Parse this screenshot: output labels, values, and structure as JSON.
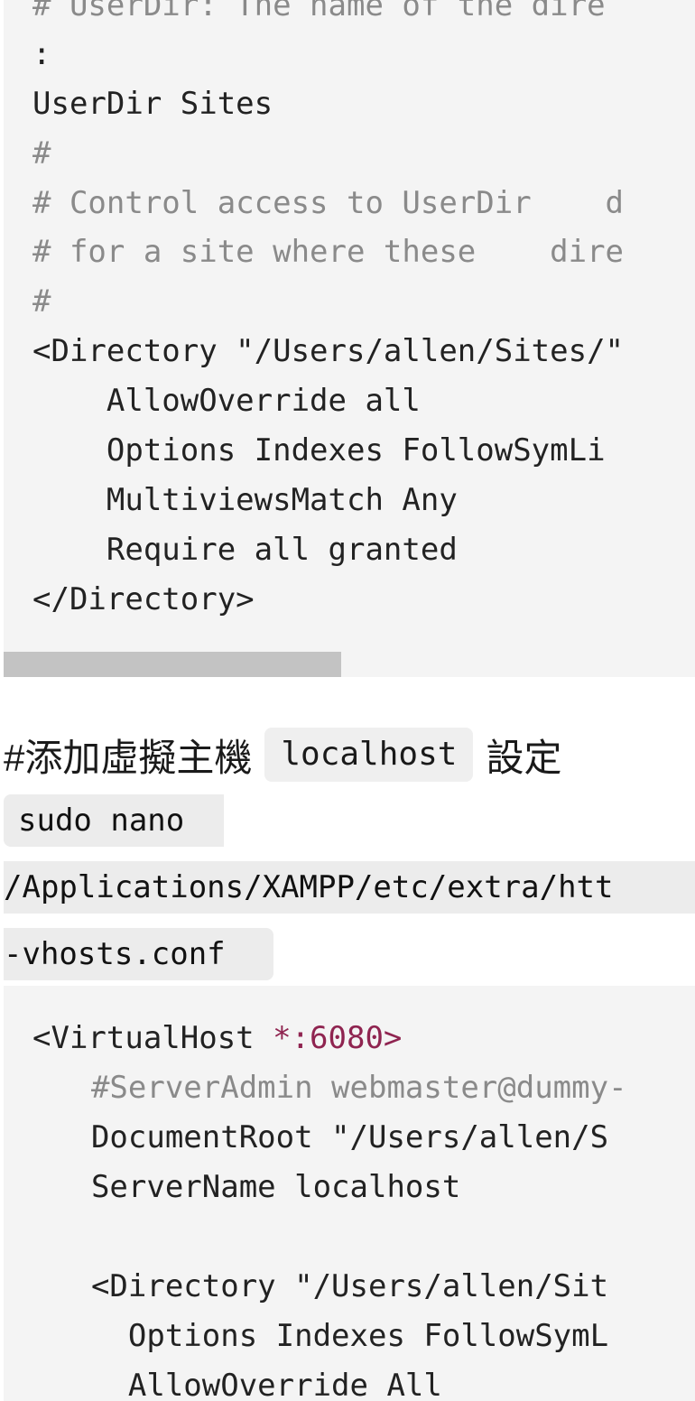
{
  "top_code": {
    "lines": [
      "# UserDir: The name of the dire",
      ":",
      "UserDir Sites",
      "#",
      "# Control access to UserDir    d",
      "# for a site where these    dire",
      "#",
      "<Directory \"/Users/allen/Sites/\"",
      "    AllowOverride all",
      "    Options Indexes FollowSymLi",
      "    MultiviewsMatch Any",
      "    Require all granted",
      "</Directory>"
    ]
  },
  "heading": {
    "prefix": "#添加虛擬主機",
    "code": "localhost",
    "suffix": "設定"
  },
  "command": {
    "line1": "sudo nano",
    "line2": "/Applications/XAMPP/etc/extra/htt",
    "line3": "-vhosts.conf"
  },
  "bottom_code": {
    "line1_tag": "<VirtualHost ",
    "line1_port": "*:6080>",
    "lines": [
      "  #ServerAdmin webmaster@dummy-",
      "  DocumentRoot \"/Users/allen/S",
      "  ServerName localhost",
      "",
      "  <Directory \"/Users/allen/Sit",
      "    Options Indexes FollowSymL",
      "    AllowOverride All"
    ]
  }
}
